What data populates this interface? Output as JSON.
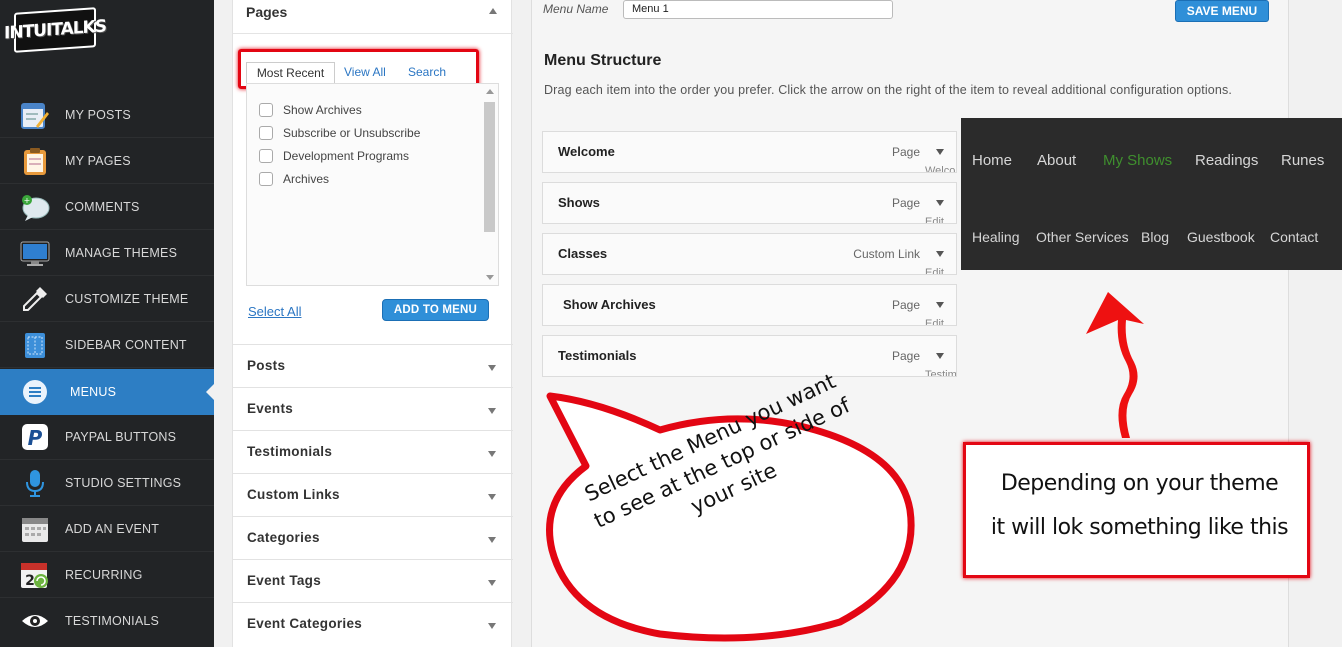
{
  "app": {
    "logo_text": "INTUITALKS"
  },
  "sidebar": {
    "items": [
      {
        "label": "MY POSTS",
        "icon": "notepad-pencil-icon"
      },
      {
        "label": "MY PAGES",
        "icon": "clipboard-icon"
      },
      {
        "label": "COMMENTS",
        "icon": "speech-bubble-icon"
      },
      {
        "label": "MANAGE THEMES",
        "icon": "monitor-icon"
      },
      {
        "label": "CUSTOMIZE THEME",
        "icon": "eyedropper-icon"
      },
      {
        "label": "SIDEBAR CONTENT",
        "icon": "sidebar-grid-icon"
      },
      {
        "label": "MENUS",
        "icon": "menu-list-icon",
        "active": true
      },
      {
        "label": "PAYPAL BUTTONS",
        "icon": "paypal-icon"
      },
      {
        "label": "STUDIO SETTINGS",
        "icon": "microphone-icon"
      },
      {
        "label": "ADD AN EVENT",
        "icon": "calendar-icon"
      },
      {
        "label": "RECURRING",
        "icon": "recurring-calendar-icon"
      },
      {
        "label": "TESTIMONIALS",
        "icon": "eye-icon"
      }
    ]
  },
  "pages_panel": {
    "title": "Pages",
    "tabs": {
      "most_recent": "Most Recent",
      "view_all": "View All",
      "search": "Search"
    },
    "checkbox_items": [
      "Show Archives",
      "Subscribe or Unsubscribe",
      "Development Programs",
      "Archives"
    ],
    "select_all": "Select All",
    "add_to_menu": "ADD TO MENU"
  },
  "accordion": [
    "Posts",
    "Events",
    "Testimonials",
    "Custom Links",
    "Categories",
    "Event Tags",
    "Event Categories"
  ],
  "menu_editor": {
    "menu_name_label": "Menu Name",
    "menu_name_value": "Menu 1",
    "save_button": "SAVE MENU",
    "structure_title": "Menu Structure",
    "structure_desc": "Drag each item into the order you prefer. Click the arrow on the right of the item to reveal additional configuration options.",
    "items": [
      {
        "name": "Welcome",
        "type": "Page",
        "peek": "Welco"
      },
      {
        "name": "Shows",
        "type": "Page",
        "peek": "Edit"
      },
      {
        "name": "Classes",
        "type": "Custom Link",
        "peek": "Edit"
      },
      {
        "name": "Show Archives",
        "type": "Page",
        "peek": "Edit"
      },
      {
        "name": "Testimonials",
        "type": "Page",
        "peek": "Testim"
      }
    ]
  },
  "theme_preview": {
    "row1": [
      "Home",
      "About",
      "My Shows",
      "Readings",
      "Runes"
    ],
    "row2": [
      "Healing",
      "Other Services",
      "Blog",
      "Guestbook",
      "Contact"
    ],
    "active_item": "My Shows",
    "active_color": "#3f8f2e"
  },
  "annotations": {
    "bubble_text": "Select the Menu you want to see at the top or side of your site",
    "note_line1": "Depending on your theme",
    "note_line2": "it will lok something like this",
    "highlight_color": "#e30613"
  }
}
